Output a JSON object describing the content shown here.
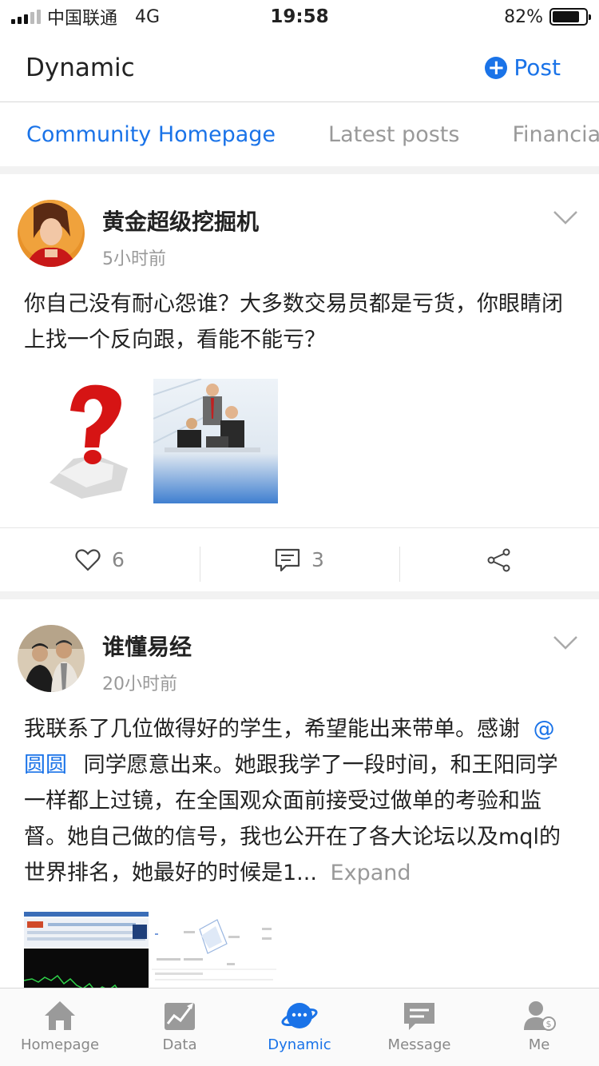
{
  "status_bar": {
    "carrier": "中国联通",
    "network": "4G",
    "time": "19:58",
    "battery": "82%",
    "battery_level": 0.82
  },
  "header": {
    "title": "Dynamic",
    "post_label": "Post"
  },
  "tabs": [
    {
      "label": "Community Homepage",
      "active": true
    },
    {
      "label": "Latest posts",
      "active": false
    },
    {
      "label": "Financial",
      "active": false
    }
  ],
  "posts": [
    {
      "author": "黄金超级挖掘机",
      "time": "5小时前",
      "text": "你自己没有耐心怨谁？大多数交易员都是亏货，你眼睛闭上找一个反向跟，看能不能亏？",
      "likes": "6",
      "comments": "3"
    },
    {
      "author": "谁懂易经",
      "time": "20小时前",
      "text_before": "我联系了几位做得好的学生，希望能出来带单。感谢",
      "mention": "@圆圆",
      "text_after": "同学愿意出来。她跟我学了一段时间，和王阳同学一样都上过镜，在全国观众面前接受过做单的考验和监督。她自己做的信号，我也公开在了各大论坛以及mql的世界排名，她最好的时候是1...",
      "expand_label": "Expand"
    }
  ],
  "bottom_nav": [
    {
      "label": "Homepage",
      "icon": "home-icon",
      "active": false
    },
    {
      "label": "Data",
      "icon": "chart-icon",
      "active": false
    },
    {
      "label": "Dynamic",
      "icon": "planet-icon",
      "active": true
    },
    {
      "label": "Message",
      "icon": "message-icon",
      "active": false
    },
    {
      "label": "Me",
      "icon": "user-icon",
      "active": false
    }
  ],
  "colors": {
    "accent": "#1a73e8",
    "muted": "#999999"
  }
}
